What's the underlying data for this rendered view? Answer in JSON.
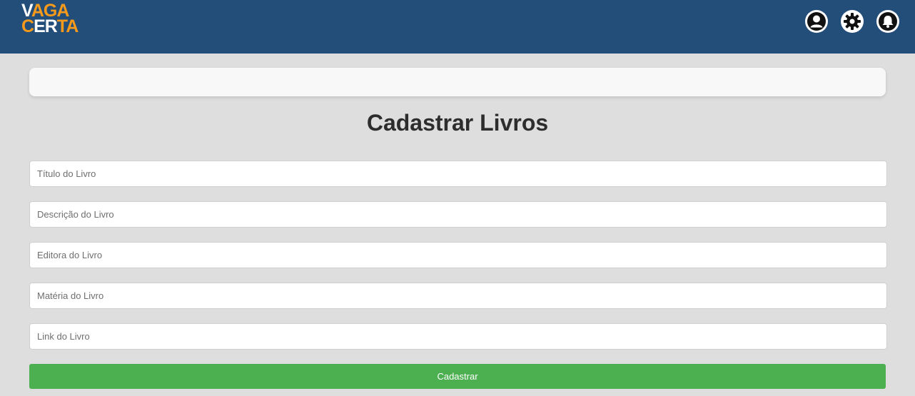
{
  "header": {
    "logo_line1": "VAGA",
    "logo_line2": "CERTA",
    "icons": [
      "user-icon",
      "gear-icon",
      "bell-icon"
    ]
  },
  "page": {
    "title": "Cadastrar Livros"
  },
  "form": {
    "fields": [
      {
        "placeholder": "Título do Livro",
        "value": ""
      },
      {
        "placeholder": "Descrição do Livro",
        "value": ""
      },
      {
        "placeholder": "Editora do Livro",
        "value": ""
      },
      {
        "placeholder": "Matéria do Livro",
        "value": ""
      },
      {
        "placeholder": "Link do Livro",
        "value": ""
      }
    ],
    "submit_label": "Cadastrar"
  },
  "colors": {
    "header_bg": "#244e7a",
    "logo_accent": "#f59a1b",
    "submit_bg": "#4caf50",
    "page_bg": "#dedede"
  }
}
